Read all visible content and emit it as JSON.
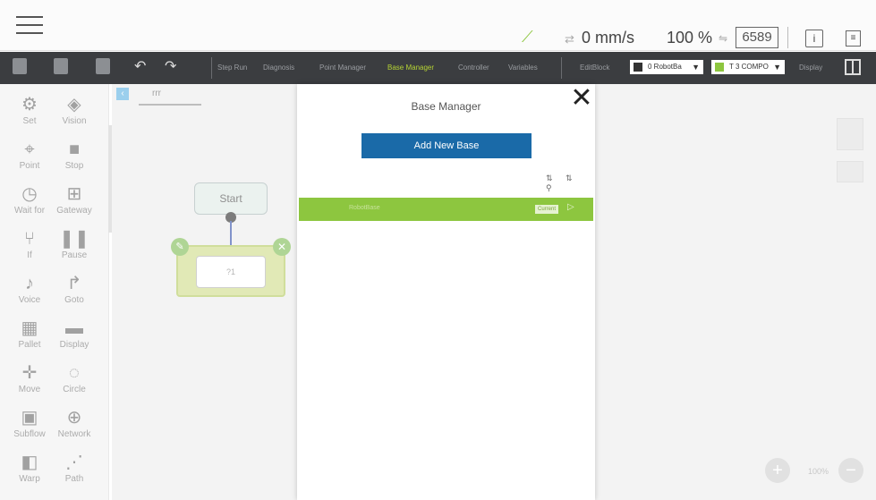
{
  "status_bar": {
    "speed": "0 mm/s",
    "percent": "100 %",
    "counter": "6589",
    "info_icon_glyph": "i",
    "doc_icon_glyph": "≡"
  },
  "toolbar": {
    "menus": [
      {
        "label": "Step Run",
        "active": false
      },
      {
        "label": "Diagnosis",
        "active": false
      },
      {
        "label": "Point Manager",
        "active": false
      },
      {
        "label": "Base Manager",
        "active": true
      },
      {
        "label": "Controller",
        "active": false
      },
      {
        "label": "Variables",
        "active": false
      },
      {
        "label": "EditBlock",
        "active": false
      }
    ],
    "robot_select": "0 RobotBa",
    "tool_select": "T 3 COMPO",
    "display_label": "Display",
    "active_color": "#b5d334"
  },
  "palette": {
    "items": [
      {
        "label": "Set",
        "icon": "set-icon",
        "glyph": "⚙"
      },
      {
        "label": "Vision",
        "icon": "vision-icon",
        "glyph": "◈"
      },
      {
        "label": "Point",
        "icon": "point-icon",
        "glyph": "⌖"
      },
      {
        "label": "Stop",
        "icon": "stop-icon",
        "glyph": "■"
      },
      {
        "label": "Wait for",
        "icon": "wait-for-icon",
        "glyph": "◷"
      },
      {
        "label": "Gateway",
        "icon": "gateway-icon",
        "glyph": "⊞"
      },
      {
        "label": "If",
        "icon": "if-icon",
        "glyph": "⑂"
      },
      {
        "label": "Pause",
        "icon": "pause-icon",
        "glyph": "❚❚"
      },
      {
        "label": "Voice",
        "icon": "voice-icon",
        "glyph": "♪"
      },
      {
        "label": "Goto",
        "icon": "goto-icon",
        "glyph": "↱"
      },
      {
        "label": "Pallet",
        "icon": "pallet-icon",
        "glyph": "▦"
      },
      {
        "label": "Display",
        "icon": "display-icon",
        "glyph": "▬"
      },
      {
        "label": "Move",
        "icon": "move-icon",
        "glyph": "✛"
      },
      {
        "label": "Circle",
        "icon": "circle-icon",
        "glyph": "◌"
      },
      {
        "label": "Subflow",
        "icon": "subflow-icon",
        "glyph": "▣"
      },
      {
        "label": "Network",
        "icon": "network-icon",
        "glyph": "⊕"
      },
      {
        "label": "Warp",
        "icon": "warp-icon",
        "glyph": "◧"
      },
      {
        "label": "Path",
        "icon": "path-icon",
        "glyph": "⋰"
      }
    ]
  },
  "canvas": {
    "tab_label": "rrr",
    "start_node": "Start",
    "if_node_text": "?1",
    "zoom_text": "100%"
  },
  "modal": {
    "title": "Base Manager",
    "add_button": "Add New Base",
    "sort_icons": "⇅ ⇅ ⚲",
    "close_glyph": "✕",
    "bases": [
      {
        "name": "RobotBase",
        "badge": "Current",
        "arrow": "▷"
      }
    ],
    "accent_color": "#1a6aa8",
    "row_color": "#8dc63f"
  }
}
